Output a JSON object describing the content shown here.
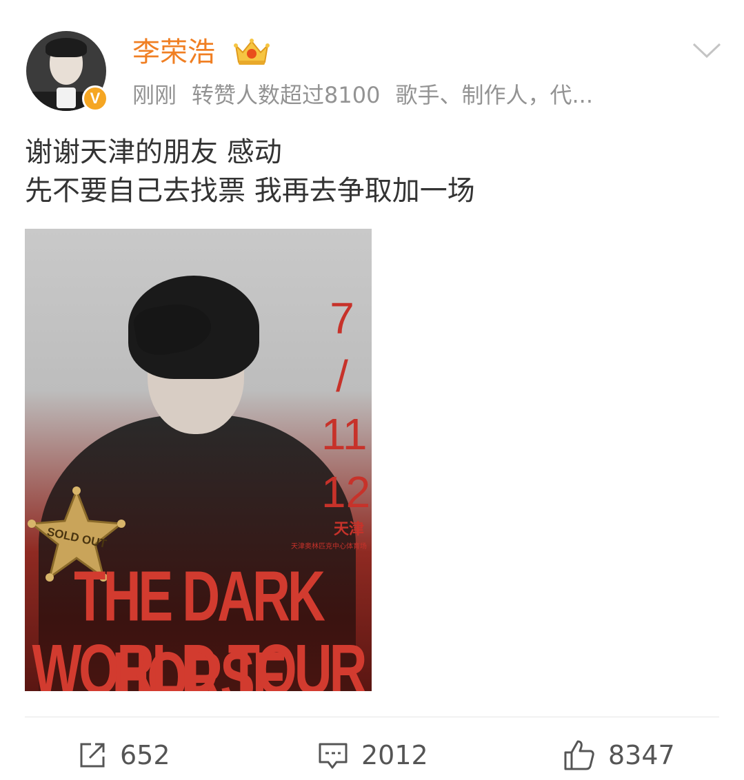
{
  "post": {
    "username": "李荣浩",
    "verified_badge": "V",
    "timestamp": "刚刚",
    "repost_note": "转赞人数超过8100",
    "bio": "歌手、制作人，代...",
    "text_line1": "谢谢天津的朋友 感动",
    "text_line2": "先不要自己去找票 我再去争取加一场"
  },
  "poster": {
    "date_lines": [
      "7",
      "/",
      "11",
      "12"
    ],
    "city": "天津",
    "venue": "天津奥林匹克中心体育场",
    "badge_text": "SOLD OUT",
    "tour_line1": "THE DARK HORSE",
    "tour_line2": "WORLD TOUR"
  },
  "actions": {
    "repost_count": "652",
    "comment_count": "2012",
    "like_count": "8347"
  },
  "icons": {
    "repost": "share-icon",
    "comment": "comment-icon",
    "like": "thumbs-up-icon",
    "menu": "chevron-down-icon",
    "member": "crown-icon"
  },
  "colors": {
    "username": "#f07f23",
    "meta": "#939393",
    "poster_red": "#c7322a"
  }
}
